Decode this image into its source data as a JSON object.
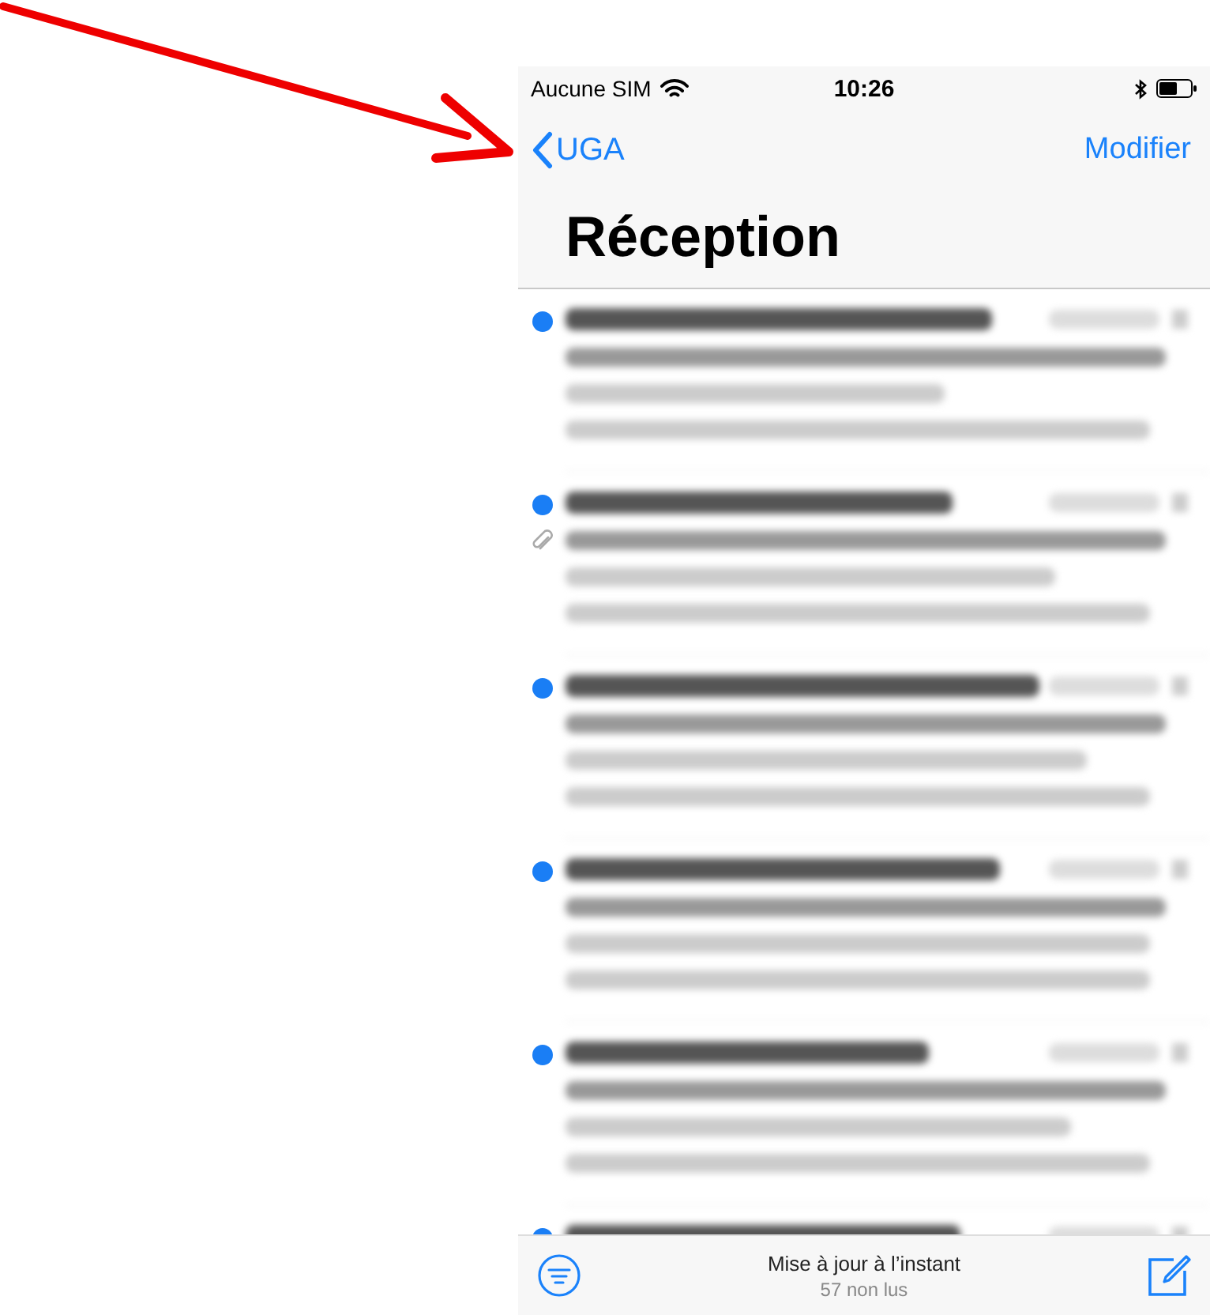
{
  "status_bar": {
    "carrier": "Aucune SIM",
    "time": "10:26"
  },
  "nav": {
    "back_label": "UGA",
    "action": "Modifier"
  },
  "title": "Réception",
  "messages": [
    {
      "unread": true,
      "attachment": false
    },
    {
      "unread": true,
      "attachment": true
    },
    {
      "unread": true,
      "attachment": false
    },
    {
      "unread": true,
      "attachment": false
    },
    {
      "unread": true,
      "attachment": false
    },
    {
      "unread": true,
      "attachment": false
    }
  ],
  "toolbar": {
    "status": "Mise à jour à l’instant",
    "unread_count": "57 non lus"
  }
}
